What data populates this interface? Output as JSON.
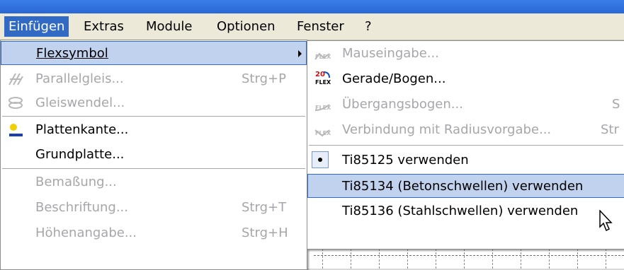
{
  "menubar": {
    "items": [
      {
        "label": "Einfügen",
        "active": true
      },
      {
        "label": "Extras"
      },
      {
        "label": "Module"
      },
      {
        "label": "Optionen"
      },
      {
        "label": "Fenster"
      },
      {
        "label": "?"
      }
    ]
  },
  "main_menu": {
    "items": [
      {
        "label": "Flexsymbol",
        "shortcut": "",
        "enabled": true,
        "highlighted": true,
        "submenu": true
      },
      {
        "label": "Parallelgleis...",
        "shortcut": "Strg+P",
        "enabled": false,
        "icon": "parallel-track-icon"
      },
      {
        "label": "Gleiswendel...",
        "shortcut": "",
        "enabled": false,
        "icon": "helix-icon"
      },
      {
        "label": "Plattenkante...",
        "shortcut": "",
        "enabled": true,
        "icon": "board-edge-icon"
      },
      {
        "label": "Grundplatte...",
        "shortcut": "",
        "enabled": true
      },
      {
        "label": "Bemaßung...",
        "shortcut": "",
        "enabled": false
      },
      {
        "label": "Beschriftung...",
        "shortcut": "Strg+T",
        "enabled": false
      },
      {
        "label": "Höhenangabe...",
        "shortcut": "Strg+H",
        "enabled": false
      }
    ]
  },
  "flex_menu": {
    "items": [
      {
        "label": "Mauseingabe...",
        "shortcut": "",
        "enabled": false,
        "icon": "flex-mouse-icon"
      },
      {
        "label": "Gerade/Bogen...",
        "shortcut": "",
        "enabled": true,
        "icon": "flex-straight-curve-icon"
      },
      {
        "label": "Übergangsbogen...",
        "shortcut": "S",
        "enabled": false,
        "icon": "flex-transition-curve-icon"
      },
      {
        "label": "Verbindung mit Radiusvorgabe...",
        "shortcut": "Str",
        "enabled": false,
        "icon": "flex-radius-connection-icon"
      },
      {
        "label": "Ti85125 verwenden",
        "enabled": true,
        "checked": true
      },
      {
        "label": "Ti85134 (Betonschwellen) verwenden",
        "enabled": true,
        "highlighted": true
      },
      {
        "label": "Ti85136 (Stahlschwellen) verwenden",
        "enabled": true
      }
    ],
    "flex_icon_text": "FLEX",
    "straight_curve_icon_text": "20"
  },
  "colors": {
    "menu_highlight": "#c1d2ee",
    "menubar_active": "#316ac5",
    "disabled_text": "#a7a6aa"
  }
}
